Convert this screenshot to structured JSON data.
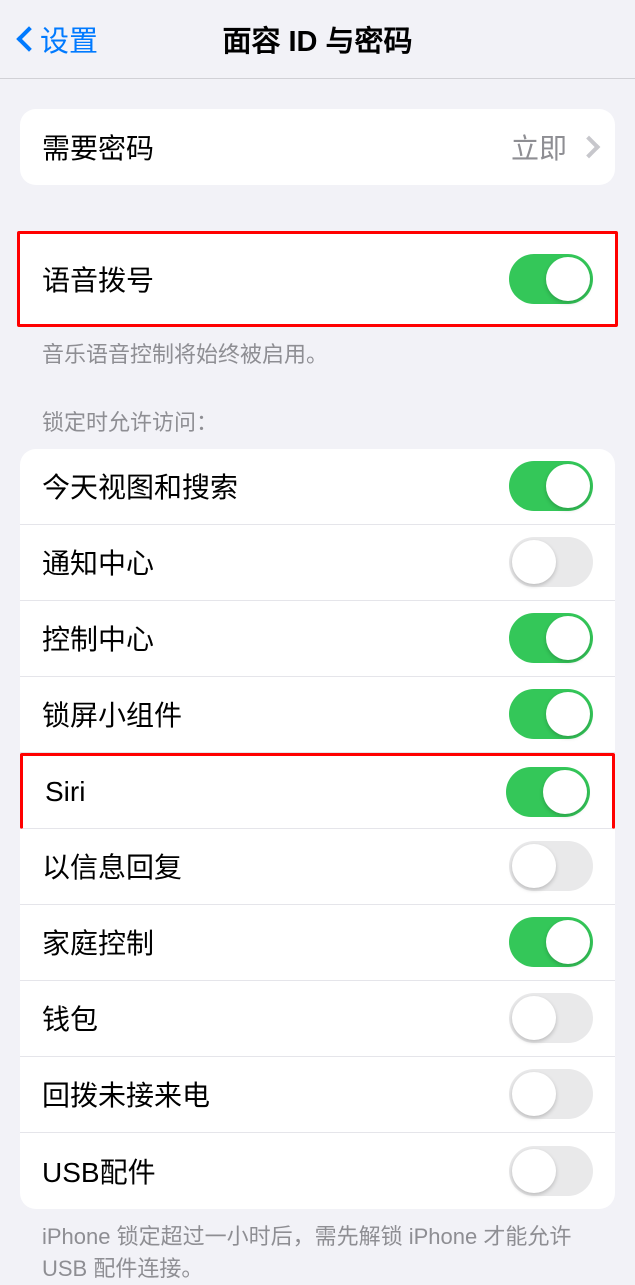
{
  "header": {
    "back_label": "设置",
    "title": "面容 ID 与密码"
  },
  "require_passcode": {
    "label": "需要密码",
    "value": "立即"
  },
  "voice_dial": {
    "label": "语音拨号",
    "enabled": true,
    "footer": "音乐语音控制将始终被启用。"
  },
  "locked_section": {
    "header": "锁定时允许访问：",
    "items": [
      {
        "label": "今天视图和搜索",
        "enabled": true
      },
      {
        "label": "通知中心",
        "enabled": false
      },
      {
        "label": "控制中心",
        "enabled": true
      },
      {
        "label": "锁屏小组件",
        "enabled": true
      },
      {
        "label": "Siri",
        "enabled": true
      },
      {
        "label": "以信息回复",
        "enabled": false
      },
      {
        "label": "家庭控制",
        "enabled": true
      },
      {
        "label": "钱包",
        "enabled": false
      },
      {
        "label": "回拨未接来电",
        "enabled": false
      },
      {
        "label": "USB配件",
        "enabled": false
      }
    ],
    "footer": "iPhone 锁定超过一小时后，需先解锁 iPhone 才能允许USB 配件连接。"
  }
}
